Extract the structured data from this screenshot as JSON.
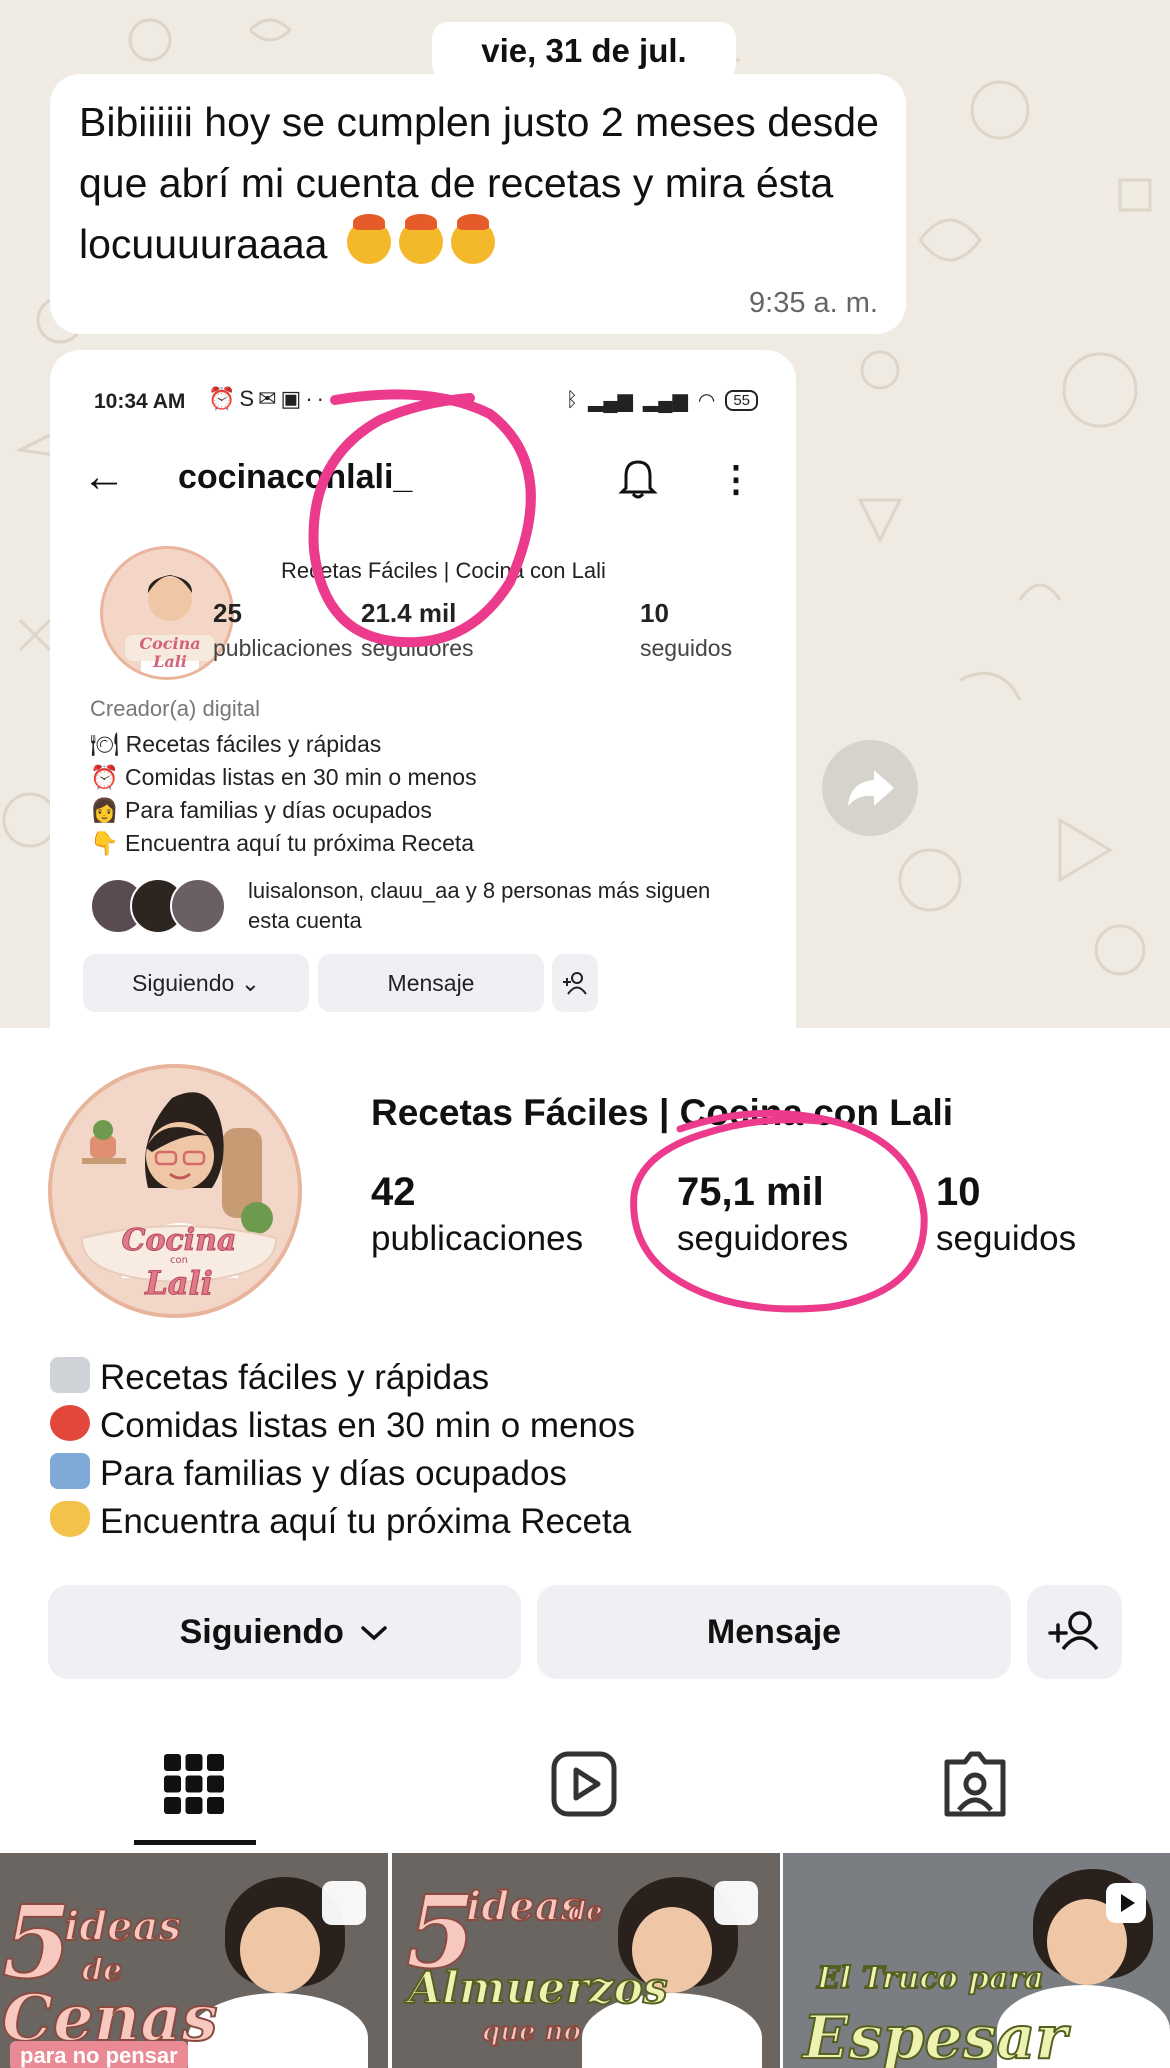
{
  "chat": {
    "date_chip": "vie, 31 de jul.",
    "message": {
      "text": "Bibiiiiii hoy se cumplen justo 2 meses desde que abrí mi cuenta de recetas y mira ésta locuuuuraaaa",
      "emoji_icons": [
        "exploding-head-emoji",
        "exploding-head-emoji",
        "exploding-head-emoji"
      ],
      "time": "9:35 a. m."
    },
    "share_icon": "forward-icon",
    "bg_color": "#efeae2"
  },
  "old_profile": {
    "status_bar": {
      "time": "10:34 AM",
      "left_icons": [
        "alarm-icon",
        "s-icon",
        "mail-icon",
        "app-icon",
        "more-dots-icon"
      ],
      "right_icons": [
        "bluetooth-icon",
        "signal-icon",
        "signal-icon",
        "wifi-icon"
      ],
      "battery": "55"
    },
    "handle": "cocinaconlali_",
    "name": "Recetas Fáciles | Cocina con Lali",
    "stats": [
      {
        "number": "25",
        "label": "publicaciones"
      },
      {
        "number": "21.4 mil",
        "label": "seguidores"
      },
      {
        "number": "10",
        "label": "seguidos"
      }
    ],
    "role": "Creador(a) digital",
    "bio": [
      "Recetas fáciles y rápidas",
      "Comidas listas en 30 min o menos",
      "Para familias y días ocupados",
      "Encuentra aquí tu próxima Receta"
    ],
    "followed_by": "luisalonson, clauu_aa y 8 personas más siguen esta cuenta",
    "buttons": {
      "following": "Siguiendo",
      "message": "Mensaje"
    },
    "highlight_color": "#ec3b8c"
  },
  "profile": {
    "name": "Recetas Fáciles | Cocina con Lali",
    "avatar_text": {
      "line1": "Cocina",
      "small": "con",
      "line2": "Lali"
    },
    "stats": [
      {
        "number": "42",
        "label": "publicaciones"
      },
      {
        "number": "75,1 mil",
        "label": "seguidores"
      },
      {
        "number": "10",
        "label": "seguidos"
      }
    ],
    "bio": [
      {
        "icon": "plate-icon",
        "text": "Recetas fáciles y rápidas"
      },
      {
        "icon": "alarm-clock-icon",
        "text": "Comidas listas en 30 min o menos"
      },
      {
        "icon": "family-icon",
        "text": "Para familias y días ocupados"
      },
      {
        "icon": "pointing-down-icon",
        "text": "Encuentra aquí tu próxima Receta"
      }
    ],
    "buttons": {
      "following": "Siguiendo",
      "message": "Mensaje"
    },
    "tabs": [
      "grid-icon",
      "reels-icon",
      "tagged-icon"
    ],
    "posts": [
      {
        "big": "5",
        "word1": "ideas",
        "word2": "de",
        "word3": "Cenas",
        "word4": "para no pensar",
        "badge": "carousel-icon"
      },
      {
        "big": "5",
        "word1": "ideas",
        "word2": "de",
        "word3": "Almuerzos",
        "word4": "que no",
        "badge": "carousel-icon"
      },
      {
        "big": "",
        "word1": "El Truco para",
        "word2": "",
        "word3": "Espesar",
        "word4": "",
        "badge": "play-icon"
      }
    ]
  }
}
